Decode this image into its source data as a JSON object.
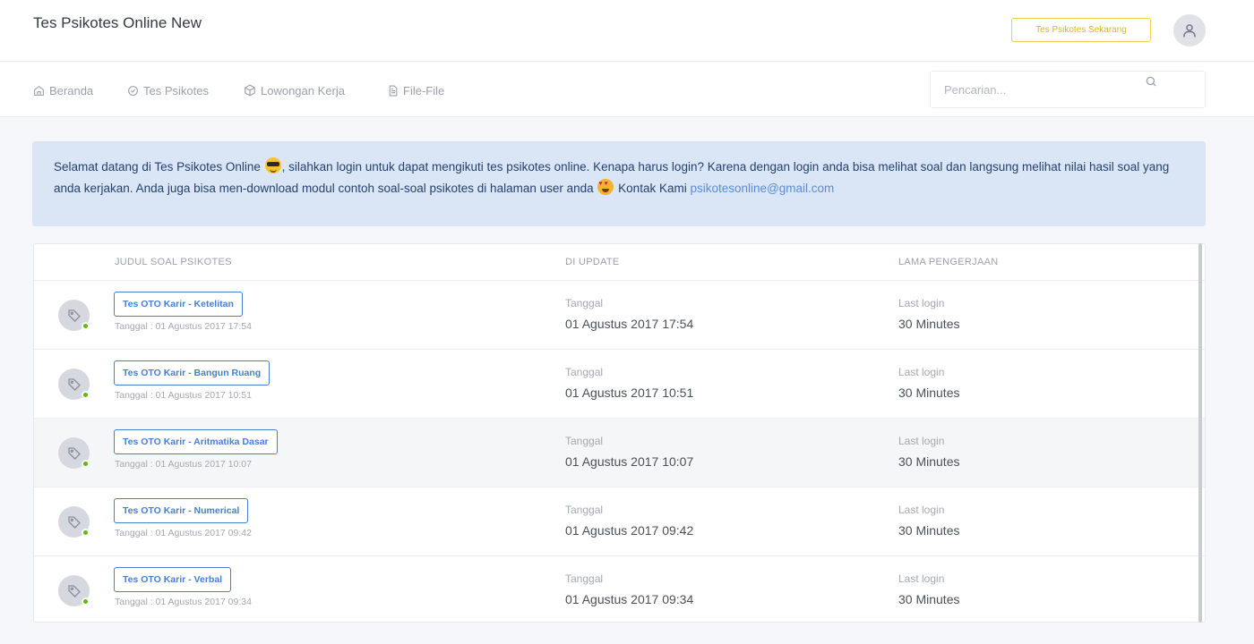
{
  "header": {
    "brand": "Tes Psikotes Online New",
    "cta_label": "Tes Psikotes Sekarang"
  },
  "nav": {
    "items": [
      {
        "label": "Beranda",
        "icon": "home-icon"
      },
      {
        "label": "Tes Psikotes",
        "icon": "check-circle-icon"
      },
      {
        "label": "Lowongan Kerja",
        "icon": "package-icon"
      },
      {
        "label": "File-File",
        "icon": "file-icon"
      }
    ],
    "search_placeholder": "Pencarian..."
  },
  "alert": {
    "text_1": "Selamat datang di Tes Psikotes Online",
    "text_2": ", silahkan login untuk dapat mengikuti tes psikotes online. Kenapa harus login? Karena dengan login anda bisa melihat soal dan langsung melihat nilai hasil soal yang anda kerjakan. Anda juga bisa men-download modul contoh soal-soal psikotes di halaman user anda",
    "text_3": "Kontak Kami",
    "email": "psikotesonline@gmail.com"
  },
  "table": {
    "headers": [
      "JUDUL SOAL PSIKOTES",
      "DI UPDATE",
      "LAMA PENGERJAAN"
    ],
    "rows": [
      {
        "title": "Tes OTO Karir - Ketelitan",
        "sub": "Tanggal : 01 Agustus 2017 17:54",
        "update_label": "Tanggal",
        "update_value": "01 Agustus 2017 17:54",
        "duration_label": "Last login",
        "duration_value": "30 Minutes"
      },
      {
        "title": "Tes OTO Karir - Bangun Ruang",
        "sub": "Tanggal : 01 Agustus 2017 10:51",
        "update_label": "Tanggal",
        "update_value": "01 Agustus 2017 10:51",
        "duration_label": "Last login",
        "duration_value": "30 Minutes"
      },
      {
        "title": "Tes OTO Karir - Aritmatika Dasar",
        "sub": "Tanggal : 01 Agustus 2017 10:07",
        "update_label": "Tanggal",
        "update_value": "01 Agustus 2017 10:07",
        "duration_label": "Last login",
        "duration_value": "30 Minutes"
      },
      {
        "title": "Tes OTO Karir - Numerical",
        "sub": "Tanggal : 01 Agustus 2017 09:42",
        "update_label": "Tanggal",
        "update_value": "01 Agustus 2017 09:42",
        "duration_label": "Last login",
        "duration_value": "30 Minutes"
      },
      {
        "title": "Tes OTO Karir - Verbal",
        "sub": "Tanggal : 01 Agustus 2017 09:34",
        "update_label": "Tanggal",
        "update_value": "01 Agustus 2017 09:34",
        "duration_label": "Last login",
        "duration_value": "30 Minutes"
      }
    ]
  },
  "colors": {
    "accent": "#467fcf",
    "alert_bg": "#dae5f5",
    "cta": "#f1d04b",
    "online": "#5eba00"
  }
}
